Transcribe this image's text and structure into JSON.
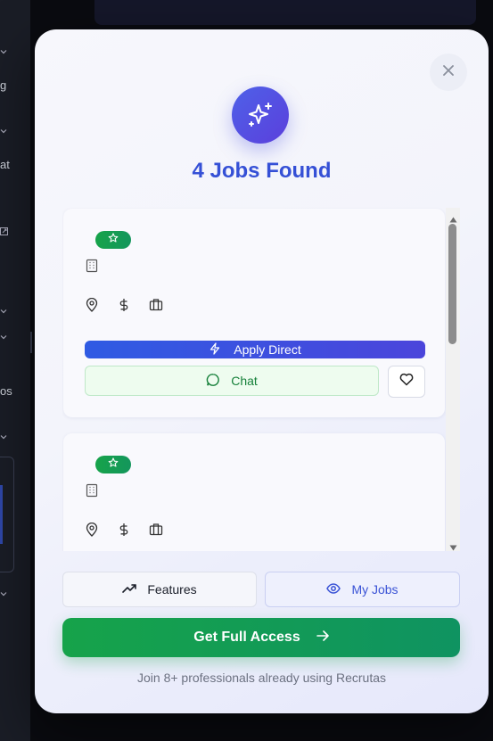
{
  "background": {
    "sidebar_fragments": [
      "g",
      "at",
      "os"
    ]
  },
  "modal": {
    "title": "4 Jobs Found",
    "cards": [
      {
        "apply_label": "Apply Direct",
        "chat_label": "Chat"
      },
      {}
    ],
    "features_label": "Features",
    "my_jobs_label": "My Jobs",
    "cta_label": "Get Full Access",
    "footer_note": "Join 8+ professionals already using Recrutas"
  },
  "colors": {
    "accent": "#3550d6",
    "success": "#16a34a",
    "apply_gradient_start": "#2f5be3",
    "apply_gradient_end": "#4b45db"
  }
}
